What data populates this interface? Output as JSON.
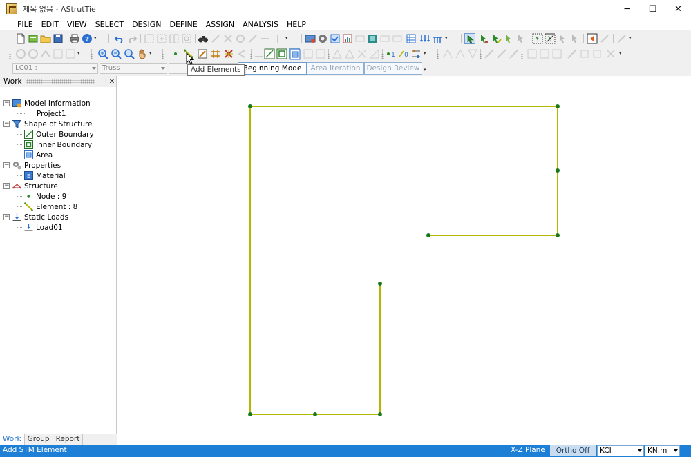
{
  "window": {
    "title": "제목 없음 - AStrutTie",
    "minimize": "─",
    "maximize": "☐",
    "close": "✕"
  },
  "menu": [
    "FILE",
    "EDIT",
    "VIEW",
    "SELECT",
    "DESIGN",
    "DEFINE",
    "ASSIGN",
    "ANALYSIS",
    "HELP"
  ],
  "selectors": {
    "load_case": "LC01 :",
    "model_type": "Truss"
  },
  "modes": {
    "beginning": "Beginning Mode",
    "iteration": "Area Iteration",
    "review": "Design Review"
  },
  "tooltip": "Add Elements",
  "panel": {
    "title": "Work",
    "pin": "⊣",
    "close": "✕",
    "tree": {
      "model_information": "Model Information",
      "project": "Project1",
      "shape_of_structure": "Shape of Structure",
      "outer_boundary": "Outer Boundary",
      "inner_boundary": "Inner Boundary",
      "area": "Area",
      "properties": "Properties",
      "material": "Material",
      "structure": "Structure",
      "node": "Node : 9",
      "element": "Element : 8",
      "static_loads": "Static Loads",
      "load": "Load01"
    },
    "tabs": [
      "Work",
      "Group",
      "Report"
    ]
  },
  "status": {
    "message": "Add STM Element",
    "plane": "X-Z Plane",
    "ortho": "Ortho Off",
    "code": "KCI",
    "unit": "KN.m"
  },
  "colors": {
    "element_line": "#b5b800",
    "node": "#1a7a1a",
    "status_bar": "#1e7fd6"
  }
}
